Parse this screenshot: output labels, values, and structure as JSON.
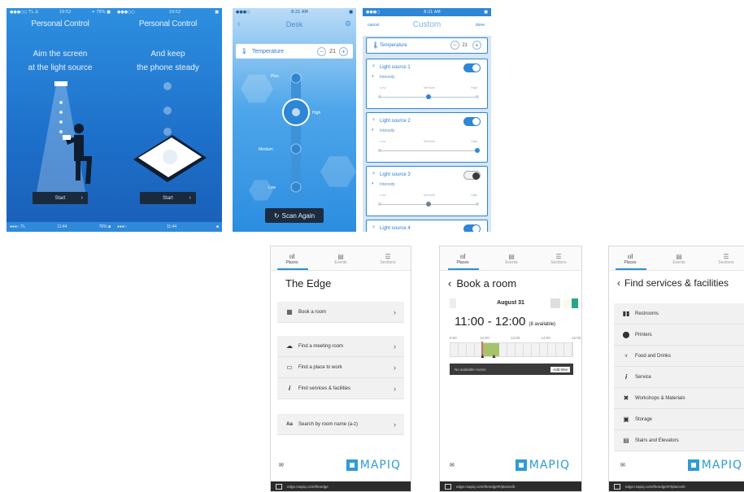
{
  "personal": {
    "title": "Personal Control",
    "left": {
      "status_left": "●●●○○ TL  ☰",
      "status_time": "19:52",
      "status_right": "✦ 76% ■",
      "instruction_line1": "Aim the screen",
      "instruction_line2": "at the light source",
      "start": "Start",
      "bottom_left": "●●●○ TL",
      "bottom_time": "11:44",
      "bottom_right": "76% ■"
    },
    "right": {
      "status_time": "19:52",
      "instruction_line1": "And keep",
      "instruction_line2": "the phone steady",
      "start": "Start",
      "bottom_time": "11:44"
    }
  },
  "desk": {
    "status_time": "8:21 AM",
    "title": "Desk",
    "row_label": "Temperature",
    "row_value": "21",
    "levels": [
      "Plus",
      "High",
      "Medium",
      "Low"
    ],
    "scan": "Scan Again"
  },
  "custom": {
    "status_time": "8:21 AM",
    "cancel": "cancel",
    "title": "Custom",
    "done": "done",
    "temp_label": "Temperature",
    "temp_value": "21",
    "cards": [
      {
        "title": "Light source 1",
        "sub": "Intensity",
        "on": true,
        "ticks": [
          "Low",
          "Medium",
          "High"
        ],
        "level": 0.5
      },
      {
        "title": "Light source 2",
        "sub": "Intensity",
        "on": true,
        "ticks": [
          "Low",
          "Medium",
          "High"
        ],
        "level": 1.0
      },
      {
        "title": "Light source 3",
        "sub": "Intensity",
        "on": false,
        "ticks": [
          "Low",
          "Medium",
          "High"
        ],
        "level": 0.5
      },
      {
        "title": "Light source 4",
        "sub": "",
        "on": true,
        "ticks": [],
        "level": 0
      }
    ]
  },
  "tabs": {
    "places": "Places",
    "events": "Events",
    "sections": "Sections"
  },
  "edge": {
    "title": "The Edge",
    "items": [
      {
        "icon": "▦",
        "label": "Book a room"
      },
      {
        "icon": "☁",
        "label": "Find a meeting room"
      },
      {
        "icon": "▭",
        "label": "Find a place to work"
      },
      {
        "icon": "𝒊",
        "label": "Find services & facilities"
      },
      {
        "icon": "Aa",
        "label": "Search by room name (a-z)"
      }
    ],
    "logo": "MAPIQ",
    "url": "edge.mapiq.com/theedge"
  },
  "book": {
    "title": "Book a room",
    "date": "August 31",
    "time": "11:00 - 12:00",
    "available": "(8 available)",
    "hours": [
      "8:00",
      "10:00",
      "12:00",
      "14:00",
      "16:00"
    ],
    "status": "No available rooms",
    "status_btn": "Add time",
    "logo": "MAPIQ",
    "url": "edge.mapiq.com/theedge#!/places/b"
  },
  "services": {
    "title": "Find services & facilities",
    "items": [
      {
        "icon": "▮▮",
        "label": "Restrooms"
      },
      {
        "icon": "⬤",
        "label": "Printers"
      },
      {
        "icon": "♆",
        "label": "Food and Drinks"
      },
      {
        "icon": "𝒊",
        "label": "Service"
      },
      {
        "icon": "✖",
        "label": "Workshops & Materials"
      },
      {
        "icon": "▣",
        "label": "Storage"
      },
      {
        "icon": "▤",
        "label": "Stairs and Elevators"
      }
    ],
    "logo": "MAPIQ",
    "url": "edge.mapiq.com/theedge/#!/places/b"
  },
  "colors": {
    "accent": "#2d86d6",
    "mapiq": "#2f9bd7",
    "dark": "#1b2c40"
  }
}
